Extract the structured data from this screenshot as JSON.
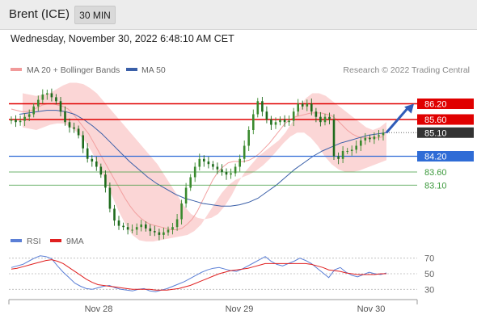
{
  "header": {
    "instrument": "Brent (ICE)",
    "timeframe": "30 MIN"
  },
  "datetime": "Wednesday, November 30, 2022 6:48:10 AM CET",
  "legend": {
    "bollinger": "MA 20 + Bollinger Bands",
    "ma50": "MA 50",
    "credit": "Research © 2022 Trading Central",
    "rsi": "RSI",
    "rsi_ma": "9MA"
  },
  "colors": {
    "candle_up": "#3a8a2e",
    "candle_down": "#1e6b1c",
    "bollinger_band": "#fbd6d6",
    "ma20": "#f2a0a0",
    "ma50": "#3a5fa8",
    "resistance": "#e00000",
    "pivot": "#2f6cd6",
    "support": "#3d9a3d",
    "rsi": "#5b7fd6",
    "rsi_ma": "#e02020",
    "arrow": "#2f5cb8"
  },
  "x_labels": [
    "Nov 28",
    "Nov 29",
    "Nov 30"
  ],
  "rsi_levels": [
    "70",
    "50",
    "30"
  ],
  "chart_data": [
    {
      "type": "candlestick",
      "title": "Brent (ICE)",
      "timeframe": "30 MIN",
      "ylim": [
        81.6,
        87.2
      ],
      "levels": [
        {
          "label": "86.20",
          "value": 86.2,
          "kind": "resistance"
        },
        {
          "label": "85.60",
          "value": 85.6,
          "kind": "resistance"
        },
        {
          "label": "85.10",
          "value": 85.1,
          "kind": "last"
        },
        {
          "label": "84.20",
          "value": 84.2,
          "kind": "pivot"
        },
        {
          "label": "83.60",
          "value": 83.6,
          "kind": "support"
        },
        {
          "label": "83.10",
          "value": 83.1,
          "kind": "support"
        }
      ],
      "close": [
        85.6,
        85.5,
        85.55,
        85.7,
        85.8,
        86.1,
        86.35,
        86.55,
        86.6,
        86.45,
        86.3,
        85.9,
        85.5,
        85.3,
        85.25,
        85.0,
        84.5,
        84.1,
        84.0,
        83.8,
        83.5,
        83.0,
        82.2,
        81.75,
        81.55,
        81.5,
        81.4,
        81.4,
        81.5,
        81.6,
        81.45,
        81.35,
        81.3,
        81.2,
        81.3,
        81.4,
        81.5,
        81.8,
        82.4,
        83.0,
        83.4,
        83.8,
        84.1,
        84.0,
        83.9,
        83.8,
        83.7,
        83.6,
        83.5,
        83.55,
        83.8,
        84.1,
        84.6,
        85.2,
        85.8,
        86.3,
        85.9,
        85.6,
        85.4,
        85.5,
        85.6,
        85.5,
        85.55,
        85.9,
        86.2,
        86.1,
        86.2,
        85.9,
        85.7,
        85.5,
        85.7,
        85.6,
        84.2,
        84.1,
        84.4,
        84.4,
        84.45,
        84.6,
        84.8,
        84.9,
        84.85,
        84.95,
        85.0,
        85.1
      ],
      "ma20": [
        86.0,
        85.95,
        85.9,
        85.9,
        85.95,
        86.05,
        86.15,
        86.2,
        86.2,
        86.15,
        86.1,
        86.0,
        85.8,
        85.55,
        85.3,
        85.05,
        84.7,
        84.35,
        84.0,
        83.65,
        83.3,
        82.95,
        82.6,
        82.3,
        82.05,
        81.85,
        81.7,
        81.6,
        81.55,
        81.5,
        81.45,
        81.4,
        81.4,
        81.45,
        81.6,
        81.8,
        82.1,
        82.5,
        82.9,
        83.3,
        83.6,
        83.8,
        83.95,
        84.0,
        84.0,
        84.0,
        84.05,
        84.15,
        84.3,
        84.5,
        84.7,
        84.95,
        85.2,
        85.45,
        85.6,
        85.7,
        85.75,
        85.8,
        85.85,
        85.85,
        85.85,
        85.8,
        85.75,
        85.6,
        85.4,
        85.2,
        85.05,
        84.95,
        84.9,
        84.9,
        84.9,
        84.9,
        84.95
      ],
      "bb_upper": [
        86.6,
        86.55,
        86.5,
        86.55,
        86.6,
        86.75,
        86.9,
        87.0,
        87.0,
        86.95,
        86.8,
        86.6,
        86.3,
        86.0,
        85.7,
        85.4,
        85.1,
        84.8,
        84.5,
        84.2,
        83.9,
        83.5,
        83.1,
        82.7,
        82.3,
        82.0,
        81.85,
        81.8,
        81.85,
        82.0,
        82.3,
        82.7,
        83.2,
        83.6,
        83.9,
        84.2,
        84.4,
        84.6,
        84.8,
        85.1,
        85.5,
        86.0,
        86.4,
        86.6,
        86.6,
        86.5,
        86.3,
        86.1,
        85.9,
        85.7,
        85.5,
        85.3,
        85.2,
        85.3,
        85.5
      ],
      "bb_lower": [
        85.3,
        85.25,
        85.2,
        85.3,
        85.4,
        85.45,
        85.45,
        85.3,
        85.1,
        84.8,
        84.4,
        83.9,
        83.3,
        82.7,
        82.1,
        81.6,
        81.2,
        81.0,
        80.95,
        80.95,
        81.0,
        81.05,
        81.1,
        81.15,
        81.2,
        81.35,
        81.6,
        82.0,
        82.4,
        82.8,
        83.1,
        83.3,
        83.4,
        83.5,
        83.65,
        83.85,
        84.1,
        84.4,
        84.7,
        84.95,
        85.1,
        85.1,
        84.9,
        84.6,
        84.2,
        83.9,
        83.7,
        83.6,
        83.6,
        83.65,
        83.75,
        83.85,
        83.95,
        84.05
      ],
      "ma50": [
        85.8,
        85.85,
        85.9,
        85.95,
        85.95,
        85.9,
        85.8,
        85.6,
        85.35,
        85.05,
        84.7,
        84.35,
        84.0,
        83.7,
        83.4,
        83.15,
        82.95,
        82.75,
        82.6,
        82.5,
        82.4,
        82.35,
        82.3,
        82.3,
        82.35,
        82.45,
        82.6,
        82.85,
        83.1,
        83.4,
        83.7,
        83.95,
        84.2,
        84.4,
        84.55,
        84.7,
        84.8,
        84.9,
        85.0,
        85.05,
        85.1
      ]
    },
    {
      "type": "line",
      "title": "RSI",
      "ylim": [
        20,
        80
      ],
      "series": [
        {
          "name": "RSI",
          "values": [
            58,
            60,
            62,
            66,
            70,
            73,
            72,
            69,
            60,
            52,
            45,
            38,
            34,
            31,
            30,
            32,
            34,
            35,
            32,
            30,
            29,
            28,
            30,
            31,
            28,
            27,
            29,
            31,
            34,
            37,
            40,
            44,
            48,
            52,
            55,
            57,
            58,
            56,
            54,
            53,
            56,
            60,
            64,
            68,
            72,
            66,
            62,
            60,
            63,
            66,
            70,
            67,
            63,
            57,
            51,
            45,
            55,
            58,
            52,
            48,
            46,
            49,
            52,
            50,
            49,
            51
          ]
        },
        {
          "name": "9MA",
          "values": [
            56,
            57,
            59,
            61,
            63,
            65,
            67,
            68,
            66,
            63,
            58,
            53,
            48,
            43,
            39,
            36,
            35,
            34,
            33,
            32,
            31,
            30,
            30,
            30,
            30,
            29,
            29,
            29,
            30,
            31,
            33,
            35,
            38,
            41,
            44,
            47,
            50,
            52,
            54,
            55,
            56,
            57,
            59,
            61,
            63,
            63,
            63,
            63,
            63,
            63,
            63,
            63,
            62,
            60,
            58,
            55,
            54,
            53,
            51,
            50,
            49,
            49,
            49,
            49,
            50,
            50
          ]
        }
      ],
      "levels": [
        70,
        50,
        30
      ]
    }
  ]
}
